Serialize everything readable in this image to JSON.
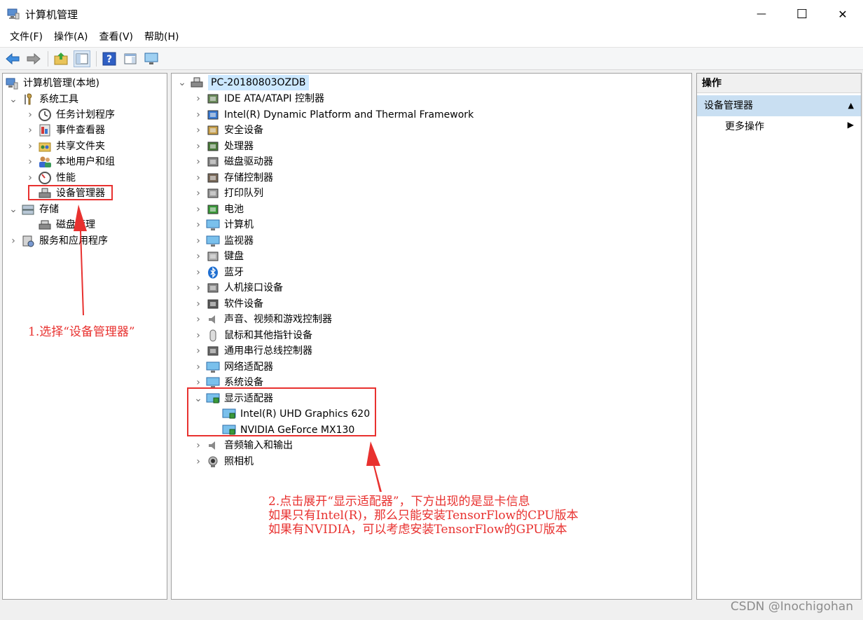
{
  "window": {
    "title": "计算机管理",
    "minimize_glyph": "—",
    "maximize_glyph": "☐",
    "close_glyph": "✕"
  },
  "menu": [
    "文件(F)",
    "操作(A)",
    "查看(V)",
    "帮助(H)"
  ],
  "toolbar_icons": [
    "back-arrow-icon",
    "forward-arrow-icon",
    "up-folder-icon",
    "show-hide-tree-icon",
    "help-icon",
    "properties-icon",
    "monitor-icon"
  ],
  "left_tree": {
    "root": "计算机管理(本地)",
    "system_tools": "系统工具",
    "task_scheduler": "任务计划程序",
    "event_viewer": "事件查看器",
    "shared_folders": "共享文件夹",
    "local_users": "本地用户和组",
    "performance": "性能",
    "device_manager": "设备管理器",
    "storage": "存储",
    "disk_management": "磁盘管理",
    "services_apps": "服务和应用程序"
  },
  "device_tree": {
    "root": "PC-20180803OZDB",
    "categories": [
      {
        "label": "IDE ATA/ATAPI 控制器",
        "icon": "ide-controller-icon"
      },
      {
        "label": "Intel(R) Dynamic Platform and Thermal Framework",
        "icon": "thermal-framework-icon"
      },
      {
        "label": "安全设备",
        "icon": "security-device-icon"
      },
      {
        "label": "处理器",
        "icon": "processor-icon"
      },
      {
        "label": "磁盘驱动器",
        "icon": "disk-drive-icon"
      },
      {
        "label": "存储控制器",
        "icon": "storage-controller-icon"
      },
      {
        "label": "打印队列",
        "icon": "printer-icon"
      },
      {
        "label": "电池",
        "icon": "battery-icon"
      },
      {
        "label": "计算机",
        "icon": "computer-icon"
      },
      {
        "label": "监视器",
        "icon": "monitor-icon"
      },
      {
        "label": "键盘",
        "icon": "keyboard-icon"
      },
      {
        "label": "蓝牙",
        "icon": "bluetooth-icon"
      },
      {
        "label": "人机接口设备",
        "icon": "hid-icon"
      },
      {
        "label": "软件设备",
        "icon": "software-device-icon"
      },
      {
        "label": "声音、视频和游戏控制器",
        "icon": "speaker-icon"
      },
      {
        "label": "鼠标和其他指针设备",
        "icon": "mouse-icon"
      },
      {
        "label": "通用串行总线控制器",
        "icon": "usb-icon"
      },
      {
        "label": "网络适配器",
        "icon": "network-adapter-icon"
      },
      {
        "label": "系统设备",
        "icon": "system-device-icon"
      }
    ],
    "display_adapters": "显示适配器",
    "adapters": [
      "Intel(R) UHD Graphics 620",
      "NVIDIA GeForce MX130"
    ],
    "after": [
      {
        "label": "音频输入和输出",
        "icon": "audio-io-icon"
      },
      {
        "label": "照相机",
        "icon": "camera-icon"
      }
    ]
  },
  "actions_pane": {
    "header": "操作",
    "section": "设备管理器",
    "more": "更多操作"
  },
  "annotations": {
    "step1": "1.选择“设备管理器”",
    "step2_line1": "2.点击展开“显示适配器”，下方出现的是显卡信息",
    "step2_line2": "如果只有Intel(R)，那么只能安装TensorFlow的CPU版本",
    "step2_line3": "如果有NVIDIA，可以考虑安装TensorFlow的GPU版本"
  },
  "watermark": "CSDN @Inochigohan",
  "colors": {
    "annotation_red": "#e8312f",
    "selection_blue": "#cce8ff",
    "section_blue": "#c9dff2"
  }
}
